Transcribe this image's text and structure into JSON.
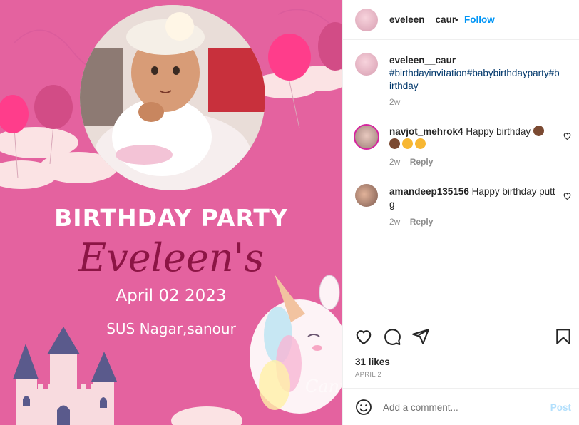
{
  "post": {
    "headline": "BIRTHDAY PARTY",
    "name": "Eveleen's",
    "event_date": "April  02 2023",
    "location": "SUS Nagar,sanour",
    "watermark": "Canva"
  },
  "header": {
    "username": "eveleen__caur",
    "separator": "•",
    "follow_label": "Follow"
  },
  "caption": {
    "username": "eveleen__caur",
    "text": "#birthdayinvitation#babybirthdayparty#birthday",
    "time": "2w"
  },
  "comments": [
    {
      "username": "navjot_mehrok4",
      "text": "Happy birthday",
      "time": "2w",
      "reply_label": "Reply"
    },
    {
      "username": "amandeep135156",
      "text": "Happy birthday putt g",
      "time": "2w",
      "reply_label": "Reply"
    }
  ],
  "actions": {
    "likes": "31 likes",
    "date": "APRIL 2"
  },
  "add_comment": {
    "placeholder": "Add a comment...",
    "post_label": "Post"
  },
  "colors": {
    "background_pink": "#e4629f",
    "name_crimson": "#8c1545",
    "link_blue": "#0095f6",
    "hashtag_navy": "#00376b",
    "post_disabled": "#b2dffc"
  },
  "icons": [
    "heart-icon",
    "comment-icon",
    "share-icon",
    "bookmark-icon",
    "emoji-icon",
    "like-comment-icon"
  ]
}
